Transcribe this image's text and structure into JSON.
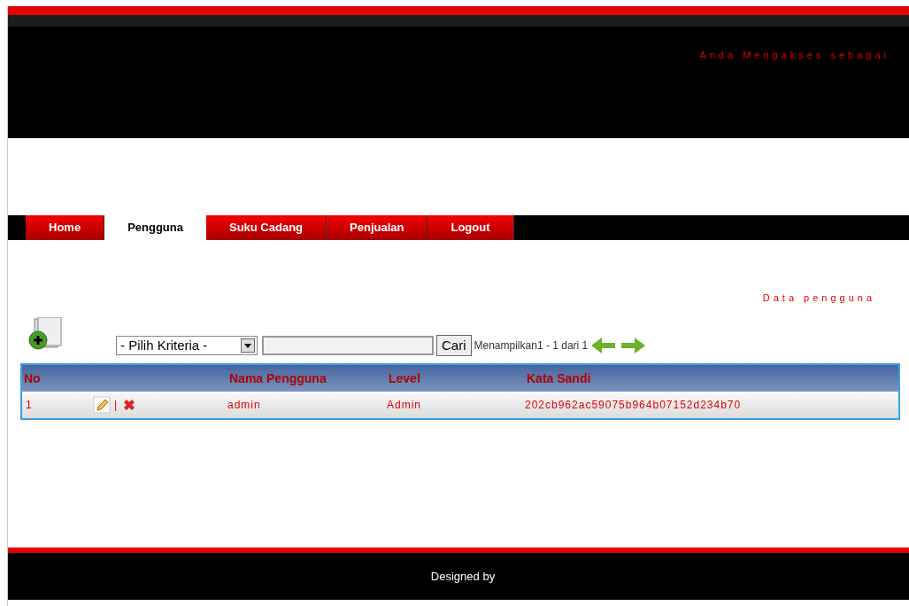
{
  "header": {
    "access_text": "Anda Mengakses sebagai"
  },
  "nav": [
    {
      "label": "Home",
      "selected": false
    },
    {
      "label": "Pengguna",
      "selected": true
    },
    {
      "label": "Suku Cadang",
      "selected": false
    },
    {
      "label": "Penjualan",
      "selected": false
    },
    {
      "label": "Logout",
      "selected": false
    }
  ],
  "page_title": "Data pengguna",
  "toolbar": {
    "criteria": "- Pilih Kriteria -",
    "search_button": "Cari",
    "paging": "Menampilkan1 - 1 dari 1"
  },
  "table": {
    "columns": [
      "No",
      "",
      "Nama Pengguna",
      "Level",
      "Kata Sandi"
    ],
    "rows": [
      {
        "no": "1",
        "separator": "|",
        "name": "admin",
        "level": "Admin",
        "password": "202cb962ac59075b964b07152d234b70"
      }
    ]
  },
  "footer": "Designed by"
}
